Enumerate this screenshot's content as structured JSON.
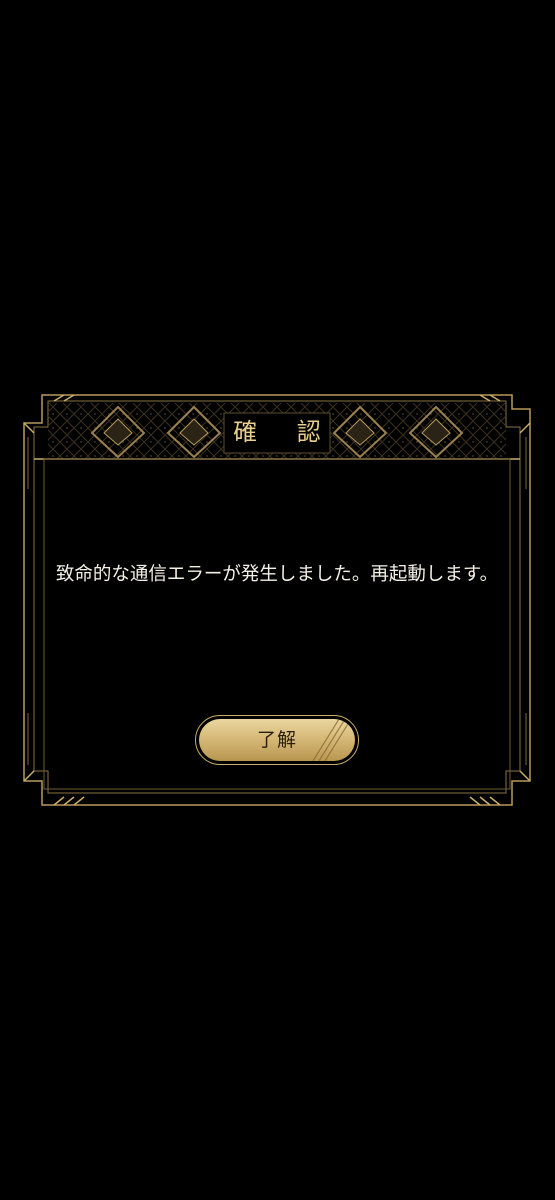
{
  "dialog": {
    "title": "確 認",
    "message": "致命的な通信エラーが発生しました。再起動します。",
    "confirm_button": "了解"
  },
  "theme": {
    "background": "#000000",
    "gold": "#c9ad6a",
    "title_color": "#e9cf8c",
    "message_color": "#f4f0e6",
    "button_text": "#2a1e0d"
  }
}
